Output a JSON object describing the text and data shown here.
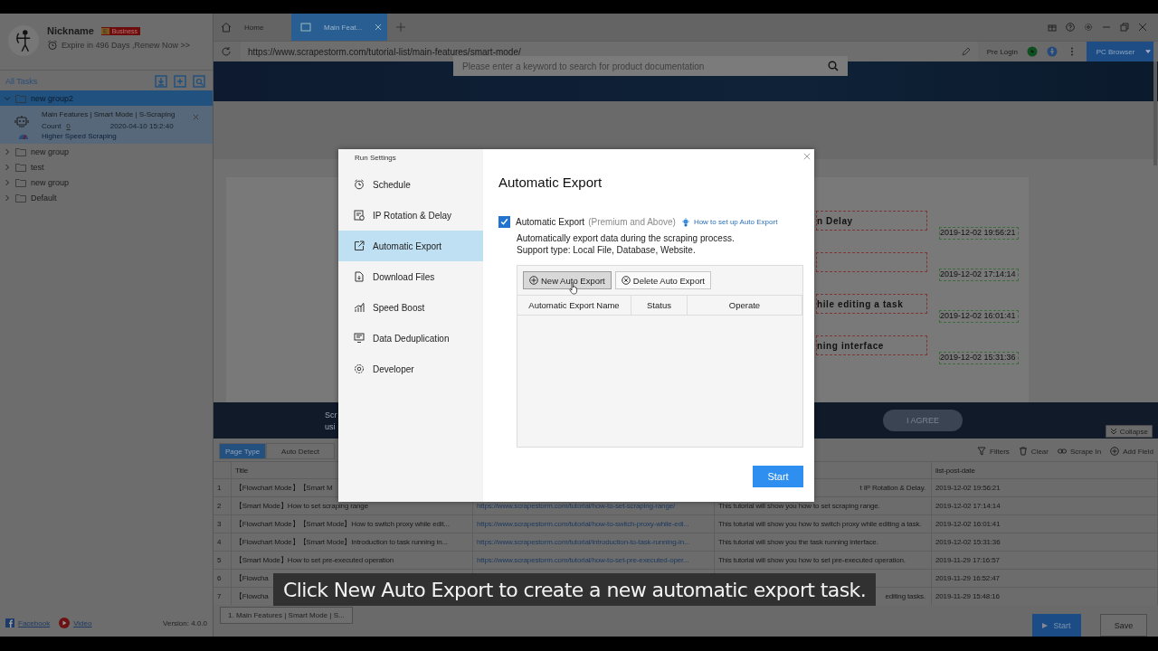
{
  "sidebar": {
    "user": {
      "name": "Nickname",
      "badge_letter": "E",
      "badge": "Business",
      "expiry": "Expire in 496 Days ,Renew Now >>"
    },
    "all_tasks": "All Tasks",
    "groups": [
      {
        "name": "new group2",
        "expanded": true,
        "selected": true,
        "tasks": [
          {
            "title": "Main Features | Smart Mode | S-Scraping",
            "count_label": "Count",
            "count": "0",
            "date": "2020-04-10 15:2:40",
            "speed": "Higher Speed Scraping"
          }
        ]
      },
      {
        "name": "new group",
        "expanded": false,
        "selected": false
      },
      {
        "name": "test",
        "expanded": false,
        "selected": false
      },
      {
        "name": "new group",
        "expanded": false,
        "selected": false
      },
      {
        "name": "Default",
        "expanded": false,
        "selected": false
      }
    ],
    "links": [
      "Facebook",
      "Video"
    ],
    "version": "Version: 4.0.0"
  },
  "browser": {
    "tabs": [
      {
        "kind": "home",
        "label": "Home",
        "selected": false
      },
      {
        "kind": "page",
        "label": "Main Feat...",
        "selected": true
      }
    ],
    "url": "https://www.scrapestorm.com/tutorial-list/main-features/smart-mode/",
    "pre_login": "Pre Login",
    "mode_button": "PC Browser"
  },
  "webpage": {
    "search_placeholder": "Please enter a keyword to search for product documentation",
    "items": [
      {
        "fragment": "n Delay",
        "date": "2019-12-02 19:56:21"
      },
      {
        "date": "2019-12-02 17:14:14"
      },
      {
        "fragment": "hile editing a task",
        "date": "2019-12-02 16:01:41"
      },
      {
        "fragment": "ning interface",
        "date": "2019-12-02 15:31:36"
      }
    ],
    "cookie_text": [
      "Scr",
      "usi"
    ],
    "agree": "I AGREE",
    "collapse": "Collapse"
  },
  "data_panel": {
    "modes": [
      {
        "label": "Page Type",
        "selected": true
      },
      {
        "label": "Auto Detect",
        "selected": false
      }
    ],
    "actions": [
      "Filters",
      "Clear",
      "Scrape In",
      "Add Field"
    ],
    "header": {
      "title": "Title",
      "date": "list-post-date"
    },
    "rows": [
      {
        "num": "1",
        "title": "【Flowchart Mode】【Smart M",
        "description": "t IP Rotation & Delay.",
        "description_cut_left": true,
        "date": "2019-12-02 19:56:21"
      },
      {
        "num": "2",
        "title": "【Smart Mode】How to set scraping range",
        "url": "https://www.scrapestorm.com/tutorial/how-to-set-scraping-range/",
        "description": "This tutorial will show you how to set scraping range.",
        "description_cut_left": false,
        "date": "2019-12-02 17:14:14"
      },
      {
        "num": "3",
        "title": "【Flowchart Mode】【Smart Mode】How to switch proxy while edit...",
        "url": "https://www.scrapestorm.com/tutorial/how-to-switch-proxy-while-edi...",
        "description": "This toturial will show you how to switch proxy while editing a task.",
        "description_cut_left": false,
        "date": "2019-12-02 16:01:41"
      },
      {
        "num": "4",
        "title": "【Flowchart Mode】【Smart Mode】Introduction to task running in...",
        "url": "https://www.scrapestorm.com/tutorial/introduction-to-task-running-in...",
        "description": "This tutorial will show you the task running interface.",
        "description_cut_left": false,
        "date": "2019-12-02 15:31:36"
      },
      {
        "num": "5",
        "title": "【Smart Mode】How to set pre-executed operation",
        "url": "https://www.scrapestorm.com/tutorial/how-to-set-pre-executed-oper...",
        "description": "This tutorial will show you how to set pre-executed operation.",
        "description_cut_left": false,
        "date": "2019-11-29 17:16:57"
      },
      {
        "num": "6",
        "title": "【Flowcha",
        "date": "2019-11-29 16:52:47"
      },
      {
        "num": "7",
        "title": "【Flowcha",
        "description": "editing tasks.",
        "description_cut_left": true,
        "date": "2019-11-29 15:48:16"
      }
    ]
  },
  "task_tabs": [
    "1. Main Features | Smart Mode | S..."
  ],
  "start": "Start",
  "save": "Save",
  "modal": {
    "title": "Run Settings",
    "nav": [
      {
        "label": "Schedule",
        "selected": false
      },
      {
        "label": "IP Rotation & Delay",
        "selected": false
      },
      {
        "label": "Automatic Export",
        "selected": true
      },
      {
        "label": "Download Files",
        "selected": false
      },
      {
        "label": "Speed Boost",
        "selected": false
      },
      {
        "label": "Data Deduplication",
        "selected": false
      },
      {
        "label": "Developer",
        "selected": false
      }
    ],
    "heading": "Automatic Export",
    "option": {
      "label": "Automatic Export",
      "note": "(Premium and Above)",
      "checked": true,
      "help_link": "How to set up Auto Export"
    },
    "description": [
      "Automatically export data during the scraping process.",
      "Support type: Local File, Database, Website."
    ],
    "buttons": [
      "New Auto Export",
      "Delete Auto Export"
    ],
    "columns": [
      "Automatic Export Name",
      "Status",
      "Operate"
    ],
    "start": "Start"
  },
  "caption": "Click New Auto Export to create a new automatic export task."
}
